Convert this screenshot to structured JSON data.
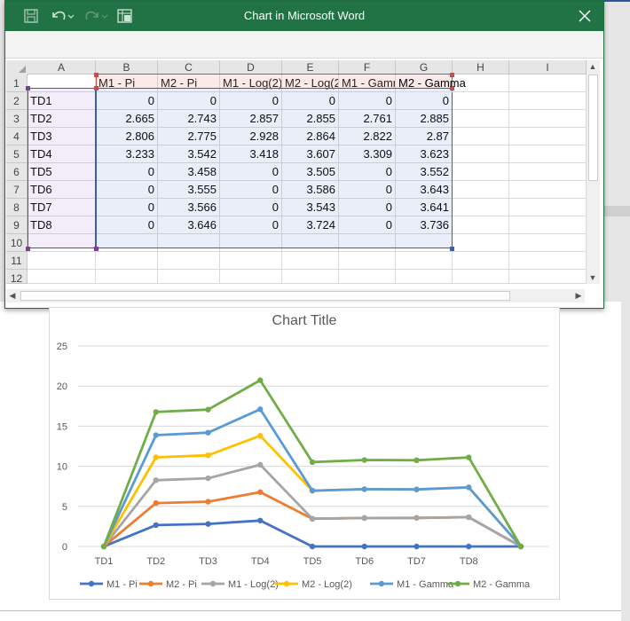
{
  "window": {
    "title": "Chart in Microsoft Word"
  },
  "toolbar": {
    "save_icon": "save-icon",
    "undo_icon": "undo-icon",
    "redo_icon": "redo-icon",
    "edit_data_icon": "edit-data-icon",
    "close_icon": "close-icon"
  },
  "sheet": {
    "column_headers": [
      "A",
      "B",
      "C",
      "D",
      "E",
      "F",
      "G",
      "H",
      "I"
    ],
    "row_headers": [
      "1",
      "2",
      "3",
      "4",
      "5",
      "6",
      "7",
      "8",
      "9",
      "10",
      "11",
      "12"
    ],
    "series_headers": [
      "M1 - Pi",
      "M2 - Pi",
      "M1 - Log(2)",
      "M2 - Log(2)",
      "M1 - Gamma",
      "M2 - Gamma"
    ],
    "rows": [
      {
        "label": "TD1",
        "values": [
          "0",
          "0",
          "0",
          "0",
          "0",
          "0"
        ]
      },
      {
        "label": "TD2",
        "values": [
          "2.665",
          "2.743",
          "2.857",
          "2.855",
          "2.761",
          "2.885"
        ]
      },
      {
        "label": "TD3",
        "values": [
          "2.806",
          "2.775",
          "2.928",
          "2.864",
          "2.822",
          "2.87"
        ]
      },
      {
        "label": "TD4",
        "values": [
          "3.233",
          "3.542",
          "3.418",
          "3.607",
          "3.309",
          "3.623"
        ]
      },
      {
        "label": "TD5",
        "values": [
          "0",
          "3.458",
          "0",
          "3.505",
          "0",
          "3.552"
        ]
      },
      {
        "label": "TD6",
        "values": [
          "0",
          "3.555",
          "0",
          "3.586",
          "0",
          "3.643"
        ]
      },
      {
        "label": "TD7",
        "values": [
          "0",
          "3.566",
          "0",
          "3.543",
          "0",
          "3.641"
        ]
      },
      {
        "label": "TD8",
        "values": [
          "0",
          "3.646",
          "0",
          "3.724",
          "0",
          "3.736"
        ]
      }
    ]
  },
  "chart_data": {
    "type": "line",
    "title": "Chart Title",
    "stacked": true,
    "categories": [
      "TD1",
      "TD2",
      "TD3",
      "TD4",
      "TD5",
      "TD6",
      "TD7",
      "TD8",
      ""
    ],
    "ylim": [
      0,
      25
    ],
    "yticks": [
      "0",
      "5",
      "10",
      "15",
      "20",
      "25"
    ],
    "grid": true,
    "legend_position": "bottom",
    "series": [
      {
        "name": "M1 - Pi",
        "color": "#4472c4",
        "values": [
          0,
          2.665,
          2.806,
          3.233,
          0,
          0,
          0,
          0,
          0
        ]
      },
      {
        "name": "M2 - Pi",
        "color": "#ed7d31",
        "values": [
          0,
          2.743,
          2.775,
          3.542,
          3.458,
          3.555,
          3.566,
          3.646,
          0
        ]
      },
      {
        "name": "M1 - Log(2)",
        "color": "#a5a5a5",
        "values": [
          0,
          2.857,
          2.928,
          3.418,
          0,
          0,
          0,
          0,
          0
        ]
      },
      {
        "name": "M2 - Log(2)",
        "color": "#ffc000",
        "values": [
          0,
          2.855,
          2.864,
          3.607,
          3.505,
          3.586,
          3.543,
          3.724,
          0
        ]
      },
      {
        "name": "M1 - Gamma",
        "color": "#5b9bd5",
        "values": [
          0,
          2.761,
          2.822,
          3.309,
          0,
          0,
          0,
          0,
          0
        ]
      },
      {
        "name": "M2 - Gamma",
        "color": "#70ad47",
        "values": [
          0,
          2.885,
          2.87,
          3.623,
          3.552,
          3.643,
          3.641,
          3.736,
          0
        ]
      }
    ]
  }
}
